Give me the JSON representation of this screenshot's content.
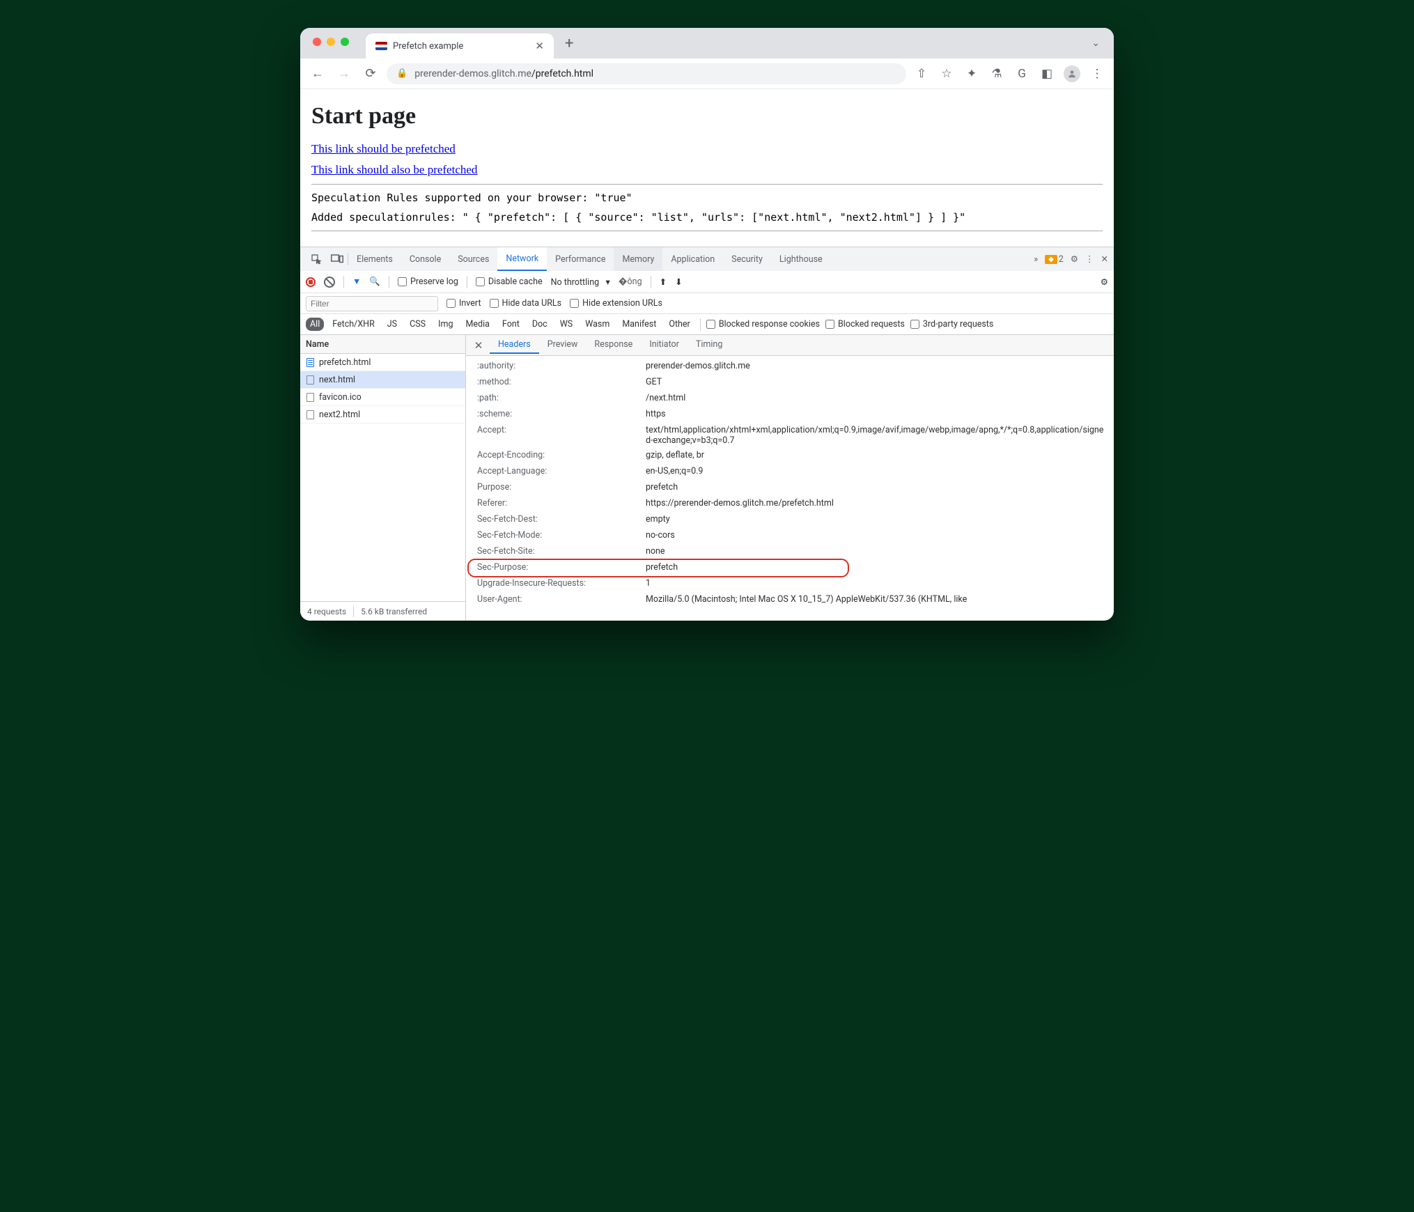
{
  "browser": {
    "tab_title": "Prefetch example",
    "url_host": "prerender-demos.glitch.me",
    "url_path": "/prefetch.html",
    "toolbar_icons": {
      "G": "G"
    }
  },
  "page": {
    "heading": "Start page",
    "link1": "This link should be prefetched",
    "link2": "This link should also be prefetched",
    "status1": "Speculation Rules supported on your browser: \"true\"",
    "status2": "Added speculationrules: \" { \"prefetch\": [ { \"source\": \"list\", \"urls\": [\"next.html\", \"next2.html\"] } ] }\""
  },
  "devtools": {
    "tabs": [
      "Elements",
      "Console",
      "Sources",
      "Network",
      "Performance",
      "Memory",
      "Application",
      "Security",
      "Lighthouse"
    ],
    "active_tab": "Network",
    "warn_count": "2",
    "toolbar": {
      "preserve_log": "Preserve log",
      "disable_cache": "Disable cache",
      "throttling": "No throttling"
    },
    "filter": {
      "placeholder": "Filter",
      "invert": "Invert",
      "hide_data": "Hide data URLs",
      "hide_ext": "Hide extension URLs"
    },
    "types": [
      "All",
      "Fetch/XHR",
      "JS",
      "CSS",
      "Img",
      "Media",
      "Font",
      "Doc",
      "WS",
      "Wasm",
      "Manifest",
      "Other"
    ],
    "type_chk": {
      "blocked_cookies": "Blocked response cookies",
      "blocked_req": "Blocked requests",
      "third": "3rd-party requests"
    },
    "reqlist_header": "Name",
    "requests": [
      {
        "name": "prefetch.html",
        "type": "doc"
      },
      {
        "name": "next.html",
        "type": "other",
        "selected": true
      },
      {
        "name": "favicon.ico",
        "type": "other"
      },
      {
        "name": "next2.html",
        "type": "other"
      }
    ],
    "detail_tabs": [
      "Headers",
      "Preview",
      "Response",
      "Initiator",
      "Timing"
    ],
    "headers": [
      {
        "k": ":authority:",
        "v": "prerender-demos.glitch.me"
      },
      {
        "k": ":method:",
        "v": "GET"
      },
      {
        "k": ":path:",
        "v": "/next.html"
      },
      {
        "k": ":scheme:",
        "v": "https"
      },
      {
        "k": "Accept:",
        "v": "text/html,application/xhtml+xml,application/xml;q=0.9,image/avif,image/webp,image/apng,*/*;q=0.8,application/signed-exchange;v=b3;q=0.7"
      },
      {
        "k": "Accept-Encoding:",
        "v": "gzip, deflate, br"
      },
      {
        "k": "Accept-Language:",
        "v": "en-US,en;q=0.9"
      },
      {
        "k": "Purpose:",
        "v": "prefetch"
      },
      {
        "k": "Referer:",
        "v": "https://prerender-demos.glitch.me/prefetch.html"
      },
      {
        "k": "Sec-Fetch-Dest:",
        "v": "empty"
      },
      {
        "k": "Sec-Fetch-Mode:",
        "v": "no-cors"
      },
      {
        "k": "Sec-Fetch-Site:",
        "v": "none"
      },
      {
        "k": "Sec-Purpose:",
        "v": "prefetch",
        "highlight": true
      },
      {
        "k": "Upgrade-Insecure-Requests:",
        "v": "1"
      },
      {
        "k": "User-Agent:",
        "v": "Mozilla/5.0 (Macintosh; Intel Mac OS X 10_15_7) AppleWebKit/537.36 (KHTML, like"
      }
    ],
    "status": {
      "requests": "4 requests",
      "transferred": "5.6 kB transferred"
    }
  }
}
